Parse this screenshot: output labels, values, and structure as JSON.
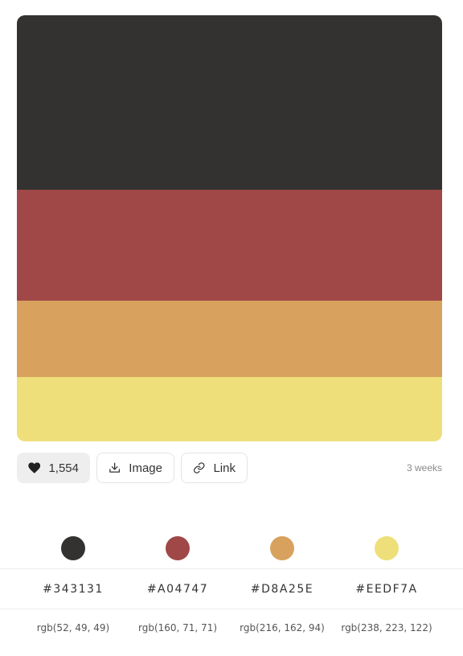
{
  "palette": {
    "colors": [
      {
        "hex": "#343131",
        "rgb": "rgb(52, 49, 49)",
        "color": "#343131",
        "share": 0.41
      },
      {
        "hex": "#A04747",
        "rgb": "rgb(160, 71, 71)",
        "color": "#A04747",
        "share": 0.26
      },
      {
        "hex": "#D8A25E",
        "rgb": "rgb(216, 162, 94)",
        "color": "#D8A25E",
        "share": 0.18
      },
      {
        "hex": "#EEDF7A",
        "rgb": "rgb(238, 223, 122)",
        "color": "#EEDF7A",
        "share": 0.15
      }
    ]
  },
  "actions": {
    "likes": "1,554",
    "like_icon": "heart-icon",
    "image_label": "Image",
    "image_icon": "download-icon",
    "link_label": "Link",
    "link_icon": "link-icon",
    "age": "3 weeks"
  }
}
